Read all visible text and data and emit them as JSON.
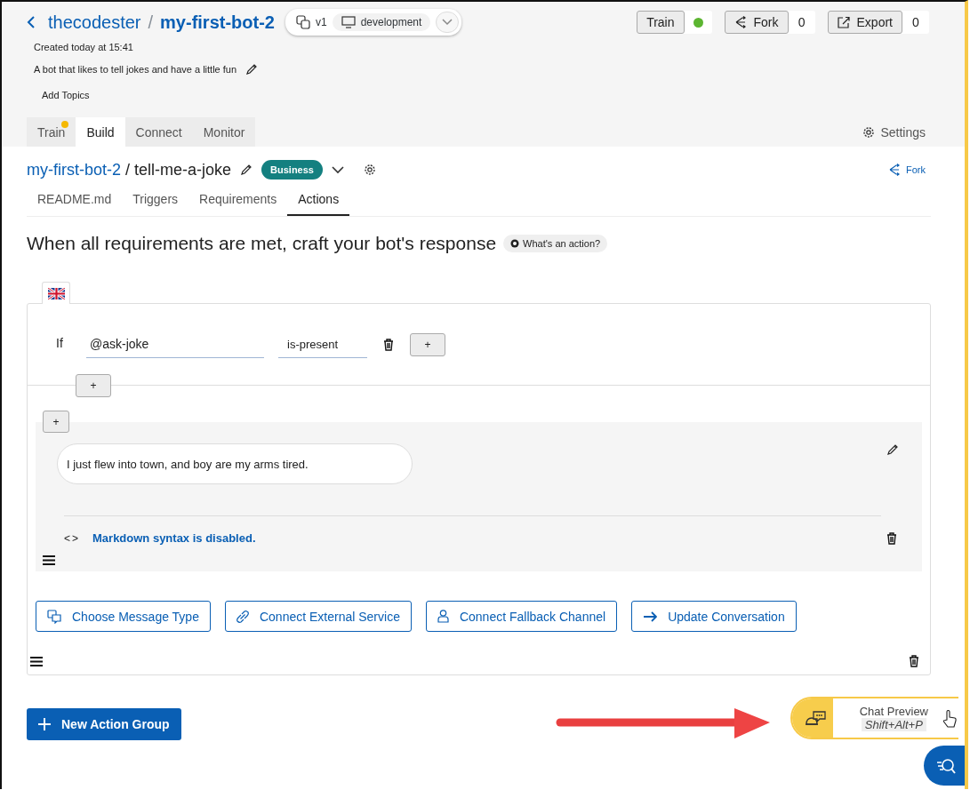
{
  "breadcrumb": {
    "owner": "thecodester",
    "separator": "/",
    "bot": "my-first-bot-2"
  },
  "version": {
    "label": "v1",
    "environment": "development"
  },
  "created": "Created today at 15:41",
  "description": "A bot that likes to tell jokes and have a little fun",
  "add_topics": "Add Topics",
  "header_actions": [
    {
      "kind": "status",
      "label": "Train",
      "color": "#5cb531"
    },
    {
      "kind": "fork",
      "label": "Fork",
      "count": "0"
    },
    {
      "kind": "export",
      "label": "Export",
      "count": "0"
    }
  ],
  "tabs": [
    {
      "label": "Train",
      "selected": false,
      "notification": true
    },
    {
      "label": "Build",
      "selected": true,
      "notification": false
    },
    {
      "label": "Connect",
      "selected": false,
      "notification": false
    },
    {
      "label": "Monitor",
      "selected": false,
      "notification": false
    }
  ],
  "settings": "Settings",
  "skill": {
    "bot": "my-first-bot-2",
    "separator": "/",
    "name": "tell-me-a-joke",
    "badge": "Business",
    "fork": "Fork"
  },
  "skill_tabs": [
    {
      "label": "README.md",
      "selected": false
    },
    {
      "label": "Triggers",
      "selected": false
    },
    {
      "label": "Requirements",
      "selected": false
    },
    {
      "label": "Actions",
      "selected": true
    }
  ],
  "heading": "When all requirements are met, craft your bot's response",
  "help": "What's an action?",
  "action_group": {
    "condition": {
      "keyword": "If",
      "entity": "@ask-joke",
      "operator": "is-present",
      "add": "+"
    },
    "add_condition": "+",
    "add_message": "+",
    "message": "I just flew into town, and boy are my arms tired.",
    "markdown_toggle": "<>",
    "markdown_note": "Markdown syntax is disabled.",
    "buttons": [
      {
        "kind": "messages",
        "label": "Choose Message Type"
      },
      {
        "kind": "link",
        "label": "Connect External Service"
      },
      {
        "kind": "person",
        "label": "Connect Fallback Channel"
      },
      {
        "kind": "arrow",
        "label": "Update Conversation"
      }
    ]
  },
  "new_group": "New Action Group",
  "chat_preview": {
    "title": "Chat Preview",
    "shortcut": "Shift+Alt+P"
  }
}
